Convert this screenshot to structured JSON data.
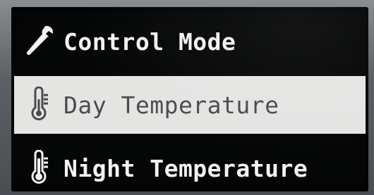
{
  "menu": {
    "items": [
      {
        "label": "Control Mode",
        "icon": "wrench-icon",
        "selected": false
      },
      {
        "label": "Day Temperature",
        "icon": "thermometer-icon",
        "selected": true
      },
      {
        "label": "Night Temperature",
        "icon": "thermometer-icon",
        "selected": false
      }
    ]
  },
  "colors": {
    "screen_background": "#050606",
    "text": "#f2f2f2",
    "highlight_background": "#e4e5e3",
    "highlight_text": "#4b4b4b"
  }
}
